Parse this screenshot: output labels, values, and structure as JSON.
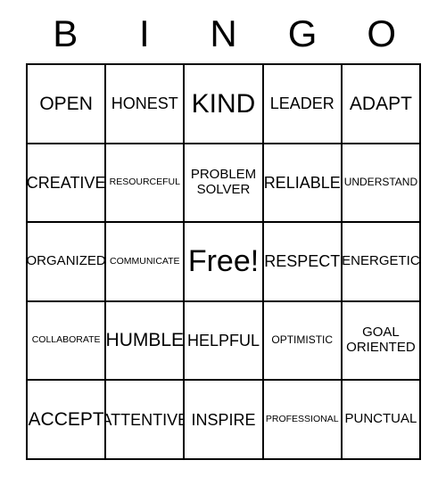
{
  "card": {
    "title": "BINGO",
    "header_letters": [
      "B",
      "I",
      "N",
      "G",
      "O"
    ],
    "free_space": "Free!",
    "colors": {
      "border": "#000000",
      "background": "#ffffff",
      "text": "#000000"
    }
  },
  "grid": {
    "columns": 5,
    "rows": 5,
    "cells": [
      [
        {
          "label": "OPEN",
          "size": "lg"
        },
        {
          "label": "HONEST",
          "size": "md"
        },
        {
          "label": "KIND",
          "size": "xl"
        },
        {
          "label": "LEADER",
          "size": "md"
        },
        {
          "label": "ADAPT",
          "size": "lg"
        }
      ],
      [
        {
          "label": "CREATIVE",
          "size": "md"
        },
        {
          "label": "RESOURCEFUL",
          "size": "xxs"
        },
        {
          "label": "PROBLEM\nSOLVER",
          "size": "sm"
        },
        {
          "label": "RELIABLE",
          "size": "md"
        },
        {
          "label": "UNDERSTAND",
          "size": "xs"
        }
      ],
      [
        {
          "label": "ORGANIZED",
          "size": "sm"
        },
        {
          "label": "COMMUNICATE",
          "size": "xxs"
        },
        {
          "label": "Free!",
          "size": "xxl"
        },
        {
          "label": "RESPECT",
          "size": "md"
        },
        {
          "label": "ENERGETIC",
          "size": "sm"
        }
      ],
      [
        {
          "label": "COLLABORATE",
          "size": "xxs"
        },
        {
          "label": "HUMBLE",
          "size": "lg"
        },
        {
          "label": "HELPFUL",
          "size": "md"
        },
        {
          "label": "OPTIMISTIC",
          "size": "xs"
        },
        {
          "label": "GOAL\nORIENTED",
          "size": "sm"
        }
      ],
      [
        {
          "label": "ACCEPT",
          "size": "lg"
        },
        {
          "label": "ATTENTIVE",
          "size": "md"
        },
        {
          "label": "INSPIRE",
          "size": "md"
        },
        {
          "label": "PROFESSIONAL",
          "size": "xxs"
        },
        {
          "label": "PUNCTUAL",
          "size": "sm"
        }
      ]
    ]
  }
}
